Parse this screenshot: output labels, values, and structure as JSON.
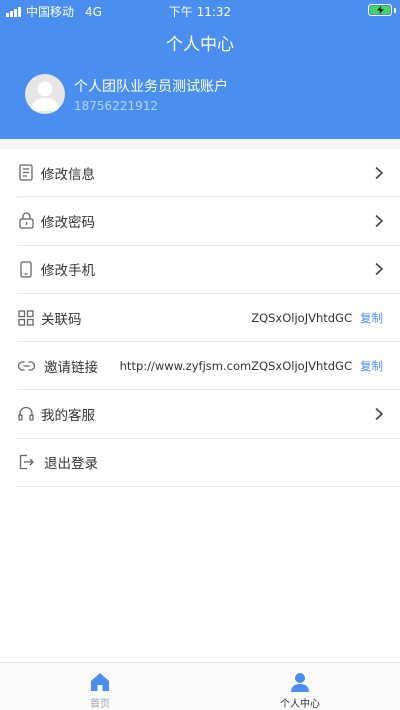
{
  "status_bar": {
    "carrier": "中国移动",
    "network": "4G",
    "time": "下午 11:32"
  },
  "header": {
    "title": "个人中心",
    "user_name": "个人团队业务员测试账户",
    "user_phone": "18756221912"
  },
  "menu": [
    {
      "icon": "document-icon",
      "label": "修改信息"
    },
    {
      "icon": "lock-icon",
      "label": "修改密码"
    },
    {
      "icon": "phone-icon",
      "label": "修改手机"
    },
    {
      "icon": "grid-icon",
      "label": "关联码",
      "value": "ZQSxOljoJVhtdGC",
      "action": "复制"
    },
    {
      "icon": "link-icon",
      "label": "邀请链接",
      "value": "http://www.zyfjsm.comZQSxOljoJVhtdGC",
      "action": "复制"
    },
    {
      "icon": "headset-icon",
      "label": "我的客服"
    },
    {
      "icon": "logout-icon",
      "label": "退出登录"
    }
  ],
  "tabbar": {
    "home_label": "首页",
    "profile_label": "个人中心"
  },
  "colors": {
    "brand": "#4a8ff0",
    "tab_inactive": "#9aa3b3"
  }
}
